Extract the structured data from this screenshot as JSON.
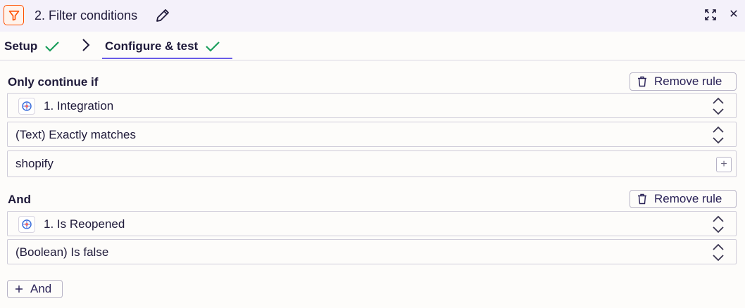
{
  "header": {
    "title": "2. Filter conditions",
    "icons": {
      "app": "filter-icon",
      "edit": "pencil-icon",
      "expand": "expand-icon",
      "close": "close-icon"
    },
    "close_glyph": "✕"
  },
  "tabs": [
    {
      "label": "Setup",
      "complete": true
    },
    {
      "label": "Configure & test",
      "complete": true,
      "active": true
    }
  ],
  "colors": {
    "accent": "#695be8",
    "check": "#1a9e5c",
    "filter_icon": "#ff4f00"
  },
  "rules": [
    {
      "label": "Only continue if",
      "remove_label": "Remove rule",
      "field": "1. Integration",
      "condition": "(Text) Exactly matches",
      "value": "shopify"
    },
    {
      "label": "And",
      "remove_label": "Remove rule",
      "field": "1. Is Reopened",
      "condition": "(Boolean) Is false"
    }
  ],
  "add_and_label": "And"
}
